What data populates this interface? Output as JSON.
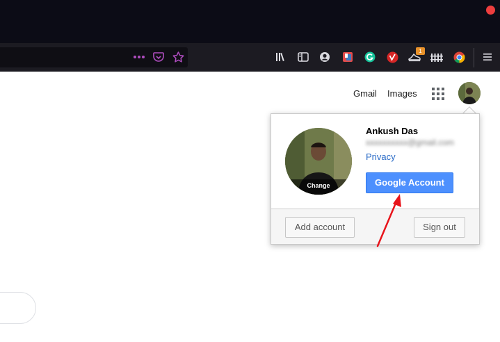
{
  "browser": {
    "toolbar_icons": [
      "library-icon",
      "sidebar-icon",
      "account-icon",
      "extension-red-icon",
      "grammarly-icon",
      "vivaldi-icon",
      "sneaker-icon",
      "fence-icon",
      "chrome-icon",
      "menu-icon"
    ],
    "notification_badge": "1"
  },
  "google": {
    "gmail_link": "Gmail",
    "images_link": "Images"
  },
  "account_popup": {
    "name": "Ankush Das",
    "email": "xxxxxxxxxx@gmail.com",
    "privacy_link": "Privacy",
    "change_photo_label": "Change",
    "google_account_button": "Google Account",
    "add_account_button": "Add account",
    "sign_out_button": "Sign out"
  },
  "colors": {
    "primary_button": "#4d90fe",
    "link": "#2a6bc7",
    "annotation_arrow": "#e8141b"
  }
}
